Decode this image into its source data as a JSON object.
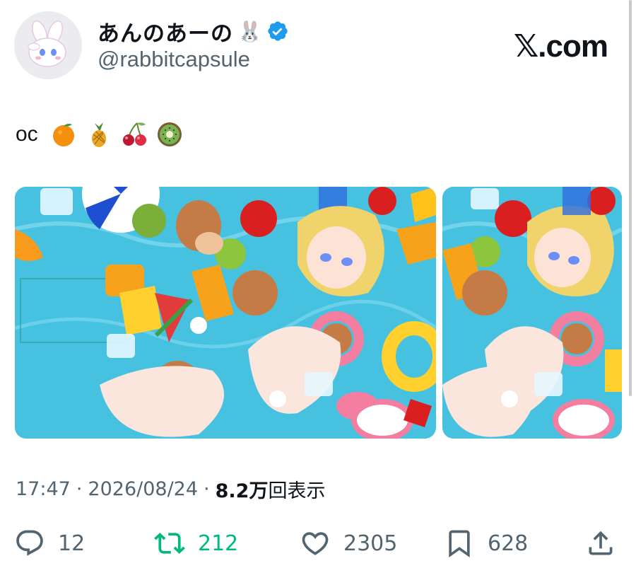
{
  "user": {
    "display_name": "あんのあーの",
    "name_emoji": "🐰",
    "handle": "@rabbitcapsule",
    "verified": true
  },
  "brand": "𝕏.com",
  "tweet": {
    "text": "oc",
    "emojis": [
      "orange-emoji",
      "pineapple-emoji",
      "cherries-emoji",
      "kiwi-emoji"
    ]
  },
  "media": [
    {
      "name": "media-image-1",
      "description_icon": "pool-illustration"
    },
    {
      "name": "media-image-2",
      "description_icon": "pool-illustration"
    }
  ],
  "meta": {
    "time": "17:47",
    "separator": "·",
    "date": "2026/08/24",
    "separator2": "·",
    "views_count": "8.2万",
    "views_label": "回表示"
  },
  "actions": {
    "replies": "12",
    "retweets": "212",
    "likes": "2305",
    "bookmarks": "628"
  },
  "colors": {
    "verified": "#1d9bf0",
    "retweet": "#00ba7c",
    "secondary_text": "#536471",
    "primary_text": "#0f1419"
  }
}
